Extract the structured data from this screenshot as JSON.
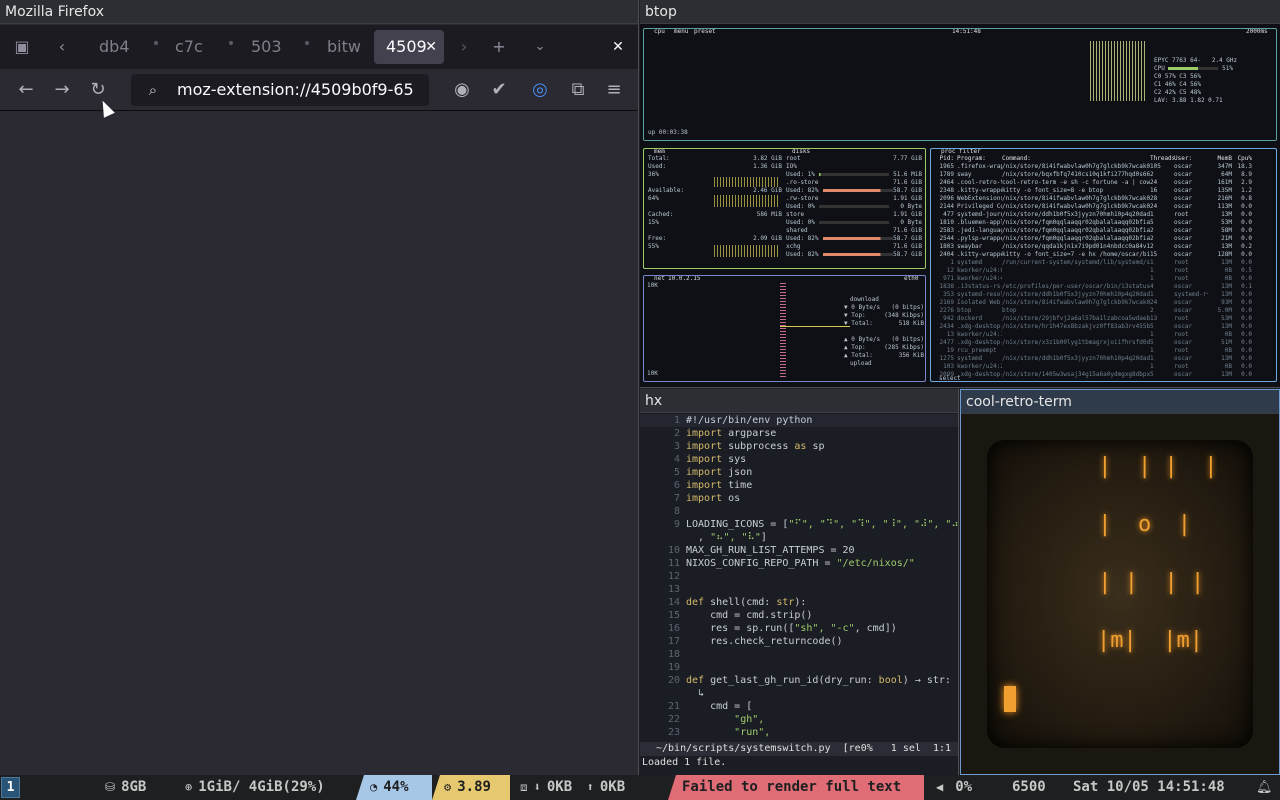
{
  "firefox": {
    "window_title": "Mozilla Firefox",
    "tabs": [
      "db4",
      "c7c",
      "503",
      "bitw",
      "4509"
    ],
    "url": "moz-extension://4509b0f9-65"
  },
  "btop": {
    "window_title": "btop",
    "cpu": {
      "label": "cpu",
      "menu": "menu",
      "preset": "preset",
      "clock": "14:51:48",
      "refresh": "2000ms",
      "model": "EPYC 7763 64-",
      "freq": "2.4 GHz",
      "uptime": "up 00:03:38",
      "lav": "LAV: 3.88 1.82 0.71",
      "rows": [
        [
          "CPU",
          "51%"
        ],
        [
          "C0",
          "57% C3",
          "56%"
        ],
        [
          "C1",
          "46% C4",
          "56%"
        ],
        [
          "C2",
          "42% C5",
          "48%"
        ]
      ]
    },
    "mem": {
      "label": "mem",
      "disks": "disks",
      "total": "Total:",
      "total_v": "3.82 GiB",
      "used": "Used:",
      "used_v": "1.36 GiB",
      "used_p": "36%",
      "avail": "Available:",
      "avail_v": "2.46 GiB",
      "avail_p": "64%",
      "cached": "Cached:",
      "cached_v": "586 MiB",
      "cached_p": "15%",
      "free": "Free:",
      "free_v": "2.09 GiB",
      "free_p": "55%",
      "disk_rows": [
        [
          "root",
          "7.77 GiB"
        ],
        [
          "IO%",
          ""
        ],
        [
          "Used: 1%",
          "51.6 MiB"
        ],
        [
          ".ro-store",
          "71.6 GiB"
        ],
        [
          "Used: 82%",
          "58.7 GiB"
        ],
        [
          ".rw-store",
          "1.91 GiB"
        ],
        [
          "Used: 0%",
          "0 Byte"
        ],
        [
          "store",
          "1.91 GiB"
        ],
        [
          "Used: 0%",
          "0 Byte"
        ],
        [
          "shared",
          "71.6 GiB"
        ],
        [
          "Used: 82%",
          "58.7 GiB"
        ],
        [
          "xchg",
          "71.6 GiB"
        ],
        [
          "Used: 82%",
          "58.7 GiB"
        ]
      ]
    },
    "net": {
      "label": "net",
      "ip": "10.0.2.15",
      "iface": "eth0",
      "scale_top": "10K",
      "scale_bot": "10K",
      "download": "download",
      "upload": "upload",
      "dl": [
        [
          "▼ 0 Byte/s",
          "(0 bitps)"
        ],
        [
          "▼ Top:",
          "(348 Kibps)"
        ],
        [
          "▼ Total:",
          "518 KiB"
        ]
      ],
      "ul": [
        [
          "▲ 0 Byte/s",
          "(0 bitps)"
        ],
        [
          "▲ Top:",
          "(285 Kibps)"
        ],
        [
          "▲ Total:",
          "356 KiB"
        ]
      ]
    },
    "proc": {
      "label": "proc",
      "filter": "filter",
      "header": [
        "Pid:",
        "Program:",
        "Command:",
        "Threads:",
        "User:",
        "MemB",
        "Cpu%"
      ],
      "footer": "select",
      "rows": [
        [
          "1965",
          ".firefox-wrappe",
          "/nix/store/8i4ifwabvlaw0h7g7glckb9k7wcak01q-firefox-13",
          "105",
          "oscar",
          "347M",
          "18.3"
        ],
        [
          "1789",
          "sway",
          "/nix/store/bqxfbfq7410cs10q1kfi277hqd0s662w6n-sway-unwra",
          "2",
          "oscar",
          "64M",
          "8.9"
        ],
        [
          "2464",
          ".cool-retro-ter",
          "cool-retro-term -e sh -c fortune -a | cowsay -r; sleep",
          "24",
          "oscar",
          "161M",
          "2.9"
        ],
        [
          "2348",
          ".kitty-wrapped",
          "kitty -o font_size=8 -e btop",
          "16",
          "oscar",
          "135M",
          "1.2"
        ],
        [
          "2096",
          "WebExtensions",
          "/nix/store/8i4ifwabvlaw0h7g7glckb9k7wcak01q-firefox-13",
          "28",
          "oscar",
          "216M",
          "0.8"
        ],
        [
          "2144",
          "Privileged Cont",
          "/nix/store/8i4ifwabvlaw0h7g7glckb9k7wcak01q-firefox-13",
          "24",
          "oscar",
          "113M",
          "0.0"
        ],
        [
          "477",
          "systemd-journal",
          "/nix/store/ddh1b0f5x3jyyzn70hmh10p4q20dadx0-systemd-25",
          "1",
          "root",
          "13M",
          "0.0"
        ],
        [
          "1810",
          ".bluemen-applet",
          "/nix/store/fqm0qqlaaqqr02qbalalaaqq02bfia-python3-3.",
          "5",
          "oscar",
          "53M",
          "0.0"
        ],
        [
          "2583",
          ".jedi-language-",
          "/nix/store/fqm0qqlaaqqr02qbalalaaqq02bfia-python3-3.",
          "2",
          "oscar",
          "58M",
          "0.0"
        ],
        [
          "2544",
          ".pylsp-wrapped",
          "/nix/store/fqm0qqlaaqqr02qbalalaaqq02bfia-python3-3.",
          "2",
          "oscar",
          "21M",
          "0.0"
        ],
        [
          "1803",
          "swaybar",
          "/nix/store/qqda1kjn1x7i9pd01n4nbdcc0a84v1d-sway-1.10.",
          "2",
          "oscar",
          "13M",
          "0.2"
        ],
        [
          "2404",
          ".kitty-wrapped",
          "kitty -o font_size=7 -e hx /home/oscar/bin/scripts/sys",
          "15",
          "oscar",
          "128M",
          "0.0"
        ],
        [
          "1",
          "systemd",
          "/run/current-system/systemd/lib/systemd/systemd",
          "1",
          "root",
          "13M",
          "0.0"
        ],
        [
          "12",
          "kworker/u24:0-ev",
          "",
          "1",
          "root",
          "0B",
          "0.5"
        ],
        [
          "971",
          "kworker/u24:4-ev",
          "",
          "1",
          "root",
          "0B",
          "0.0"
        ],
        [
          "1838",
          ".i3status-rs-wr",
          "/etc/profiles/per-user/oscar/bin/i3status-rs config-bo",
          "4",
          "oscar",
          "13M",
          "0.1"
        ],
        [
          "353",
          "systemd-resolve",
          "/nix/store/ddh1b0f5x3jyyzn70hmh10p4q20dadx0-systemd-25",
          "1",
          "systemd-r+",
          "13M",
          "0.0"
        ],
        [
          "2169",
          "Isolated Web Co",
          "/nix/store/8i4ifwabvlaw0h7g7glckb9k7wcak01q-firefox-13",
          "24",
          "oscar",
          "93M",
          "0.0"
        ],
        [
          "2276",
          "btop",
          "btop",
          "2",
          "oscar",
          "5.0M",
          "0.0"
        ],
        [
          "942",
          "dockerd",
          "/nix/store/29jbfvj2a6al57ba1lzabcoa5wdaeby-docker-27.5.",
          "13",
          "root",
          "53M",
          "0.0"
        ],
        [
          "2434",
          ".xdg-desktop-po",
          "/nix/store/hr1h47ex8bzakjvz0ff83ab3rv455b2j-xdg-deskto",
          "5",
          "oscar",
          "13M",
          "0.0"
        ],
        [
          "13",
          "kworker/u24:1-ev",
          "",
          "1",
          "root",
          "0B",
          "0.0"
        ],
        [
          "2477",
          ".xdg-desktop-po",
          "/nix/store/x3z1b00lyg1tbmagrxjoiifhrsfd0dpx-xdg-deskto",
          "5",
          "oscar",
          "51M",
          "0.0"
        ],
        [
          "19",
          "rcu_preempt",
          "",
          "1",
          "root",
          "0B",
          "0.0"
        ],
        [
          "1275",
          "systemd",
          "/nix/store/ddh1b0f5x3jyyzn70hmh10p4q20dadx0-systemd-25",
          "1",
          "oscar",
          "13M",
          "0.0"
        ],
        [
          "103",
          "kworker/u24:2-ev",
          "",
          "1",
          "root",
          "0B",
          "0.0"
        ],
        [
          "2099",
          ".xdg-desktop-po",
          "/nix/store/1405w3wsaj34g15a6a0ydmgxg8dbpx-xdg-deskto",
          "5",
          "oscar",
          "13M",
          "0.0"
        ]
      ]
    }
  },
  "hx": {
    "window_title": "hx",
    "lines": [
      {
        "n": "1",
        "t": "#!/usr/bin/env python"
      },
      {
        "n": "2",
        "kw": "import",
        "t": " argparse"
      },
      {
        "n": "3",
        "kw": "import",
        "t": " subprocess ",
        "kw2": "as",
        "t2": " sp"
      },
      {
        "n": "4",
        "kw": "import",
        "t": " sys"
      },
      {
        "n": "5",
        "kw": "import",
        "t": " json"
      },
      {
        "n": "6",
        "kw": "import",
        "t": " time"
      },
      {
        "n": "7",
        "kw": "import",
        "t": " os"
      },
      {
        "n": "8",
        "t": ""
      },
      {
        "n": "9",
        "t": "LOADING_ICONS = [",
        "s": "\"⠋\", \"⠙\", \"⠹\", \"⠸\", \"⠼\", \"⠴\""
      },
      {
        "n": "",
        "t": "  , ",
        "s": "\"⠦\", \"⠧\"",
        "t2": "]"
      },
      {
        "n": "10",
        "t": "MAX_GH_RUN_LIST_ATTEMPS = 20"
      },
      {
        "n": "11",
        "t": "NIXOS_CONFIG_REPO_PATH = ",
        "s": "\"/etc/nixos/\""
      },
      {
        "n": "12",
        "t": ""
      },
      {
        "n": "13",
        "t": ""
      },
      {
        "n": "14",
        "kw": "def",
        "t": " shell(cmd: ",
        "kw2": "str",
        "t2": "):"
      },
      {
        "n": "15",
        "t": "    cmd = cmd.strip()"
      },
      {
        "n": "16",
        "t": "    res = sp.run([",
        "s": "\"sh\", \"-c\"",
        "t2": ", cmd])"
      },
      {
        "n": "17",
        "t": "    res.check_returncode()"
      },
      {
        "n": "18",
        "t": ""
      },
      {
        "n": "19",
        "t": ""
      },
      {
        "n": "20",
        "kw": "def",
        "t": " get_last_gh_run_id(dry_run: ",
        "kw2": "bool",
        "t2": ") → str:"
      },
      {
        "n": "",
        "t": "  ↳"
      },
      {
        "n": "21",
        "t": "    cmd = ["
      },
      {
        "n": "22",
        "t": "        ",
        "s": "\"gh\","
      },
      {
        "n": "23",
        "t": "        ",
        "s": "\"run\","
      }
    ],
    "status": "~/bin/scripts/systemswitch.py  [re0%   1 sel  1:1",
    "message": "Loaded 1 file."
  },
  "crt": {
    "window_title": "cool-retro-term",
    "art": [
      " |  | |  |",
      " |  o  |",
      " | |  | |",
      "|m|  |m|"
    ]
  },
  "bar": {
    "workspace": "1",
    "disk": "8GB",
    "mem": "1GiB/ 4GiB(29%)",
    "cpu": "44%",
    "load": "3.89",
    "net_down": "0KB",
    "net_up": "0KB",
    "error": "Failed to render full text",
    "volume": "0%",
    "temp": "6500",
    "datetime": "Sat 10/05 14:51:48",
    "colors": {
      "cpu_bg": "#a7c7e7",
      "load_bg": "#e6c86e",
      "error_bg": "#e06c75"
    }
  }
}
